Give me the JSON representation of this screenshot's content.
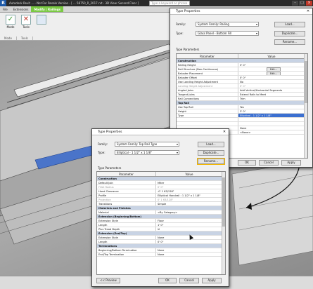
{
  "app": {
    "title": "Autodesk Revit ... - Not For Resale Version - [ ... 58750_R_2017.rvt - 3D View: Second Floor ]",
    "search_placeholder": "Type a keyword or phrase",
    "tabs": [
      "File",
      "Extensions",
      "Modify | Railings"
    ],
    "ribbon_buttons": [
      "Mode",
      "Tools"
    ],
    "ribbon_groups": [
      "Mode",
      "Tools"
    ]
  },
  "dialog_back": {
    "title": "Type Properties",
    "family_label": "Family:",
    "family_value": "System Family: Railing",
    "type_label": "Type:",
    "type_value": "Glass Panel - Bottom Fill",
    "load_button": "Load...",
    "duplicate_button": "Duplicate...",
    "rename_button": "Rename...",
    "type_parameters_label": "Type Parameters",
    "col_parameter": "Parameter",
    "col_value": "Value",
    "rows": [
      {
        "kind": "group",
        "p": "Construction",
        "v": ""
      },
      {
        "kind": "row",
        "p": "Railing Height",
        "v": "3' 0\""
      },
      {
        "kind": "edit",
        "p": "Rail Structure (Non-Continuous)",
        "v": "Edit..."
      },
      {
        "kind": "edit",
        "p": "Baluster Placement",
        "v": "Edit..."
      },
      {
        "kind": "row",
        "p": "Baluster Offset",
        "v": "0' 0\""
      },
      {
        "kind": "row",
        "p": "Use Landing Height Adjustment",
        "v": "No"
      },
      {
        "kind": "disabled",
        "p": "Landing Height Adjustment",
        "v": "0' 0\""
      },
      {
        "kind": "row",
        "p": "Angled Joins",
        "v": "Add Vertical/Horizontal Segments"
      },
      {
        "kind": "row",
        "p": "Tangent Joins",
        "v": "Extend Rails to Meet"
      },
      {
        "kind": "row",
        "p": "Rail Connections",
        "v": "Trim"
      },
      {
        "kind": "group",
        "p": "Top Rail",
        "v": ""
      },
      {
        "kind": "row",
        "p": "Use Top Rail",
        "v": "Yes"
      },
      {
        "kind": "row",
        "p": "Height",
        "v": "3' 0\""
      },
      {
        "kind": "sel",
        "p": "Type",
        "v": "Elliptical - 1 1/2\" x 1 1/8\""
      },
      {
        "kind": "row",
        "p": "",
        "v": ""
      },
      {
        "kind": "row",
        "p": "",
        "v": ""
      },
      {
        "kind": "row",
        "p": "",
        "v": "None"
      },
      {
        "kind": "row",
        "p": "",
        "v": "<None>"
      }
    ],
    "ok_button": "OK",
    "cancel_button": "Cancel",
    "apply_button": "Apply"
  },
  "dialog_front": {
    "title": "Type Properties",
    "family_label": "Family:",
    "family_value": "System Family: Top Rail Type",
    "type_label": "Type:",
    "type_value": "Elliptical - 1 1/2\" x 1 1/8\"",
    "load_button": "Load...",
    "duplicate_button": "Duplicate...",
    "rename_button": "Rename...",
    "type_parameters_label": "Type Parameters",
    "col_parameter": "Parameter",
    "col_value": "Value",
    "rows": [
      {
        "kind": "group",
        "p": "Construction",
        "v": ""
      },
      {
        "kind": "row",
        "p": "Default Join",
        "v": "Miter"
      },
      {
        "kind": "disabled",
        "p": "Fillet Radius",
        "v": "0' 0\""
      },
      {
        "kind": "row",
        "p": "Hand Clearance",
        "v": "-0' 1 63/128\""
      },
      {
        "kind": "row",
        "p": "Profile",
        "v": "Elliptical Handrail : 1 1/2\" x 1 1/8\""
      },
      {
        "kind": "disabled",
        "p": "Projection",
        "v": "0' 1 63/128\""
      },
      {
        "kind": "row",
        "p": "Transitions",
        "v": "Simple"
      },
      {
        "kind": "group",
        "p": "Materials and Finishes",
        "v": ""
      },
      {
        "kind": "row",
        "p": "Material",
        "v": "<By Category>"
      },
      {
        "kind": "group",
        "p": "Extension (Beginning/Bottom)",
        "v": ""
      },
      {
        "kind": "row",
        "p": "Extension Style",
        "v": "Floor"
      },
      {
        "kind": "row",
        "p": "Length",
        "v": "1' 0\""
      },
      {
        "kind": "check",
        "p": "Plus Tread Depth",
        "v": "☑"
      },
      {
        "kind": "group",
        "p": "Extension (End/Top)",
        "v": ""
      },
      {
        "kind": "row",
        "p": "Extension Style",
        "v": "None"
      },
      {
        "kind": "row",
        "p": "Length",
        "v": "0' 0\""
      },
      {
        "kind": "group",
        "p": "Terminations",
        "v": ""
      },
      {
        "kind": "row",
        "p": "Beginning/Bottom Termination",
        "v": "None"
      },
      {
        "kind": "row",
        "p": "End/Top Termination",
        "v": "None"
      }
    ],
    "preview_button": "<< Preview",
    "ok_button": "OK",
    "cancel_button": "Cancel",
    "apply_button": "Apply"
  },
  "colors": {
    "accent_green": "#7ac943",
    "group_row": "#c8d3e4",
    "selection": "#3b6fd0",
    "highlight_ring": "#f2b705",
    "railing_blue": "#4a74c9"
  }
}
